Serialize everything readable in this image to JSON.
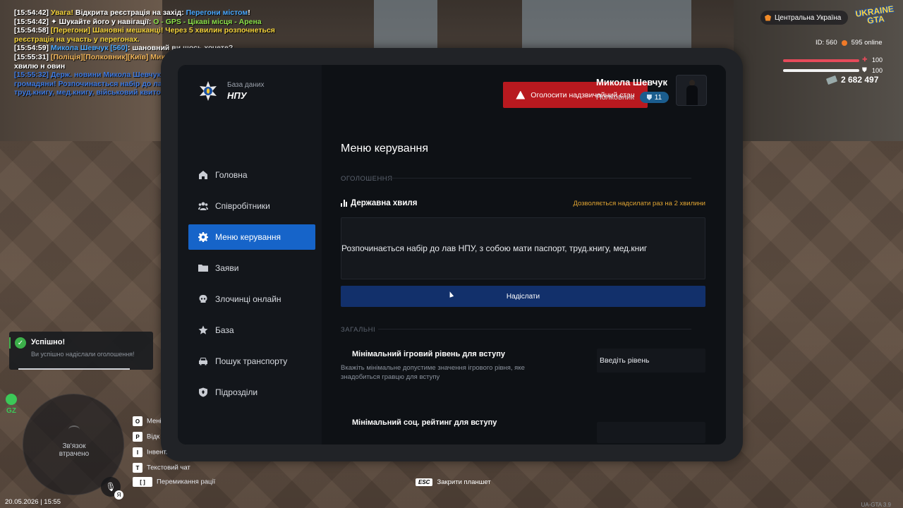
{
  "chat": [
    {
      "time": "[15:54:42]",
      "parts": [
        {
          "t": " Увага! ",
          "c": "c-yel"
        },
        {
          "t": "Відкрита реєстрація на захід: ",
          "c": ""
        },
        {
          "t": "Перегони містом",
          "c": "c-blu"
        },
        {
          "t": "!",
          "c": ""
        }
      ]
    },
    {
      "time": "[15:54:42]",
      "parts": [
        {
          "t": " ✦  Шукайте його у навігації: ",
          "c": ""
        },
        {
          "t": "O - GPS - Цікаві місця - Арена",
          "c": "c-grn"
        }
      ]
    },
    {
      "time": "[15:54:58]",
      "parts": [
        {
          "t": " [Перегони] Шановні мешканці! Через 5 хвилин розпочнеться реєстрація на участь у перегонах.",
          "c": "c-yel"
        }
      ]
    },
    {
      "time": "[15:54:59]",
      "parts": [
        {
          "t": " Микола Шевчук ",
          "c": "c-blu"
        },
        {
          "t": "[560]",
          "c": "c-blu"
        },
        {
          "t": ": шановний ви  щось хочете?",
          "c": ""
        }
      ]
    },
    {
      "time": "[15:55:31]",
      "parts": [
        {
          "t": " [Поліція][Полковник][Київ] Микола Шевчук [560]: ",
          "c": "c-org"
        },
        {
          "t": "Займаю хвилю н овин",
          "c": ""
        }
      ]
    },
    {
      "time": "[15:55:32]",
      "parts": [
        {
          "t": " Держ. новини Микола Шевчук[560] : [НПУ] Шановні громадяни! Розпочинається набір до лав НПУ, з собою мати паспорт, труд.книгу, мед.книгу, військовий квиток. Очікуємо в холі м. Київ",
          "c": "c-dblu"
        }
      ],
      "all": "c-dblu"
    }
  ],
  "hud": {
    "region": "Центральна Україна",
    "logo_line1": "UKRAINE",
    "logo_line2": "GTA",
    "id_label": "ID: 560",
    "online": "595 online",
    "health": "100",
    "armor": "100",
    "health_fraction": 1,
    "armor_fraction": 1,
    "money": "2 682 497"
  },
  "tablet": {
    "brand_sub": "База даних",
    "brand_title": "НПУ",
    "emergency_label": "Оголосити надзвичайний стан",
    "profile_name": "Микола Шевчук",
    "profile_rank": "Полковник",
    "rank_level": "11",
    "nav": [
      {
        "label": "Головна",
        "icon": "home-icon",
        "active": false
      },
      {
        "label": "Співробітники",
        "icon": "users-icon",
        "active": false
      },
      {
        "label": "Меню керування",
        "icon": "gear-icon",
        "active": true
      },
      {
        "label": "Заяви",
        "icon": "folder-icon",
        "active": false
      },
      {
        "label": "Злочинці онлайн",
        "icon": "skull-icon",
        "active": false
      },
      {
        "label": "База",
        "icon": "star-icon",
        "active": false
      },
      {
        "label": "Пошук транспорту",
        "icon": "car-icon",
        "active": false
      },
      {
        "label": "Підрозділи",
        "icon": "shield-icon",
        "active": false
      }
    ],
    "page_title": "Меню керування",
    "section_announce": "ОГОЛОШЕННЯ",
    "wave_title": "Державна хвиля",
    "wave_hint": "Дозволяється надсилати раз на 2 хвилини",
    "message_text": "Розпочинається набір до лав НПУ, з собою мати паспорт, труд.книгу, мед.книг",
    "send_label": "Надіслати",
    "section_general": "ЗАГАЛЬНІ",
    "setting1_title": "Мінімальний ігровий рівень для вступу",
    "setting1_desc": "Вкажіть мінімальне допустиме значення ігрового рівня, яке знадобиться гравцю для вступу",
    "setting1_placeholder": "Введіть рівень",
    "setting2_title": "Мінімальний соц. рейтинг для вступу"
  },
  "notification": {
    "title": "Успішно!",
    "text": "Ви успішно надіслали оголошення!"
  },
  "bottom": {
    "gz": "GZ",
    "connection_lost": "Зв'язок\nвтрачено",
    "mic_key": "Я",
    "keys": [
      {
        "key": "O",
        "label": "Мені"
      },
      {
        "key": "P",
        "label": "Відк"
      },
      {
        "key": "I",
        "label": "Інвент."
      },
      {
        "key": "T",
        "label": "Текстовий чат"
      },
      {
        "key": "[ ]",
        "label": "Перемикання рації"
      }
    ],
    "datetime": "20.05.2026 | 15:55",
    "esc_key": "ESC",
    "esc_label": "Закрити планшет",
    "version": "UA-GTA 3.9"
  }
}
